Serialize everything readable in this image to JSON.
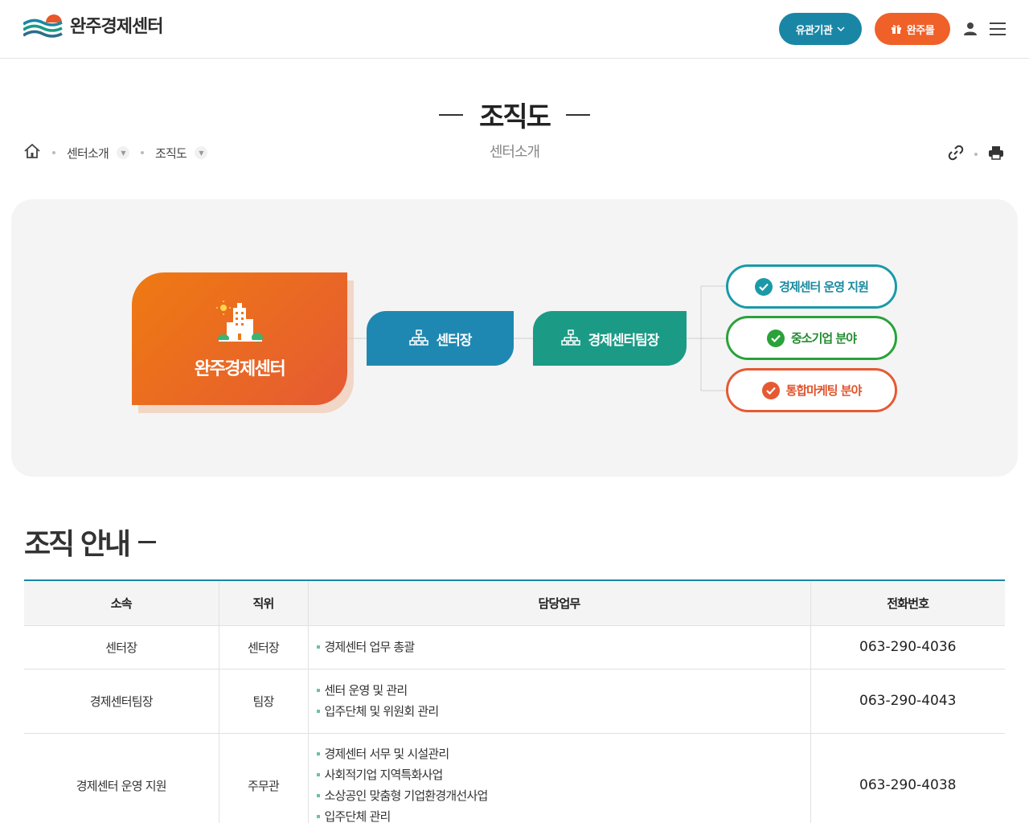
{
  "header": {
    "logo_text": "완주경제센터",
    "related_button": "유관기관",
    "mall_button": "완주몰",
    "icons": {
      "user": "user-icon",
      "menu": "hamburger-menu-icon",
      "gift": "gift-icon",
      "chevron": "chevron-down-icon"
    },
    "colors": {
      "related": "#1a86a6",
      "mall": "#ef6129"
    }
  },
  "page": {
    "title": "조직도",
    "subtitle": "센터소개"
  },
  "breadcrumb": {
    "home_icon": "home-icon",
    "items": [
      "센터소개",
      "조직도"
    ]
  },
  "tools": {
    "share_icon": "link-icon",
    "print_icon": "printer-icon"
  },
  "org_chart": {
    "main": "완주경제센터",
    "center_head": "센터장",
    "team_head": "경제센터팀장",
    "departments": [
      "경제센터 운영 지원",
      "중소기업 분야",
      "통합마케팅 분야"
    ],
    "colors": {
      "main": "#ef7a12",
      "center": "#1f88b2",
      "team": "#1b9b86",
      "dept1": "#1a9aa8",
      "dept2": "#2aa23a",
      "dept3": "#e55a33"
    }
  },
  "section": {
    "title": "조직 안내"
  },
  "table": {
    "headers": [
      "소속",
      "직위",
      "담당업무",
      "전화번호"
    ],
    "rows": [
      {
        "dept": "센터장",
        "position": "센터장",
        "duties": [
          "경제센터 업무 총괄"
        ],
        "phone": "063-290-4036"
      },
      {
        "dept": "경제센터팀장",
        "position": "팀장",
        "duties": [
          "센터 운영 및 관리",
          "입주단체 및 위원회 관리"
        ],
        "phone": "063-290-4043"
      },
      {
        "dept": "경제센터 운영 지원",
        "position": "주무관",
        "duties": [
          "경제센터 서무 및 시설관리",
          "사회적기업 지역특화사업",
          "소상공인 맞춤형 기업환경개선사업",
          "입주단체 관리"
        ],
        "phone": "063-290-4038"
      }
    ]
  }
}
